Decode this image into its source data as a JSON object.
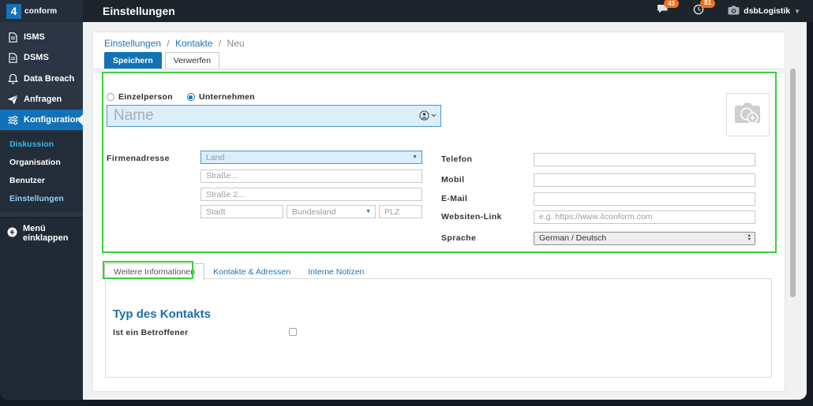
{
  "topbar": {
    "logo_mark": "4",
    "logo_text": "conform",
    "title": "Einstellungen",
    "chat_badge": "43",
    "tasks_badge": "81",
    "user_name": "dsbLogistik"
  },
  "sidebar": {
    "items": [
      {
        "label": "ISMS"
      },
      {
        "label": "DSMS"
      },
      {
        "label": "Data Breach"
      },
      {
        "label": "Anfragen"
      },
      {
        "label": "Konfiguration"
      }
    ],
    "subitems": [
      {
        "label": "Diskussion"
      },
      {
        "label": "Organisation"
      },
      {
        "label": "Benutzer"
      },
      {
        "label": "Einstellungen"
      }
    ],
    "active_item": "Konfiguration",
    "active_subitem": "Einstellungen",
    "collapse_label": "Menü einklappen"
  },
  "breadcrumb": {
    "part1": "Einstellungen",
    "part2": "Kontakte",
    "part3": "Neu",
    "separator": "/"
  },
  "actions": {
    "save_label": "Speichern",
    "discard_label": "Verwerfen"
  },
  "form": {
    "person_type": {
      "option1": "Einzelperson",
      "option2": "Unternehmen",
      "selected": "Unternehmen"
    },
    "name_placeholder": "Name",
    "address": {
      "label": "Firmenadresse",
      "country_placeholder": "Land",
      "street_placeholder": "Straße...",
      "street2_placeholder": "Straße 2...",
      "city_placeholder": "Stadt",
      "state_placeholder": "Bundesland",
      "zip_placeholder": "PLZ"
    },
    "contact": {
      "phone_label": "Telefon",
      "mobile_label": "Mobil",
      "email_label": "E-Mail",
      "website_label": "Websiten-Link",
      "website_placeholder": "e.g. https://www.4conform.com",
      "language_label": "Sprache",
      "language_value": "German / Deutsch"
    }
  },
  "tabs": {
    "tab1": "Weitere Informationen",
    "tab2": "Kontakte & Adressen",
    "tab3": "Interne Notizen",
    "active": "Weitere Informationen"
  },
  "tab_content": {
    "heading": "Typ des Kontakts",
    "checkbox_label": "Ist ein Betroffener",
    "checkbox_checked": false
  },
  "colors": {
    "accent_blue": "#1273b8",
    "annotation_green": "#3ad03a",
    "badge_orange": "#f2701d",
    "cyan_link": "#2fb9ea"
  }
}
